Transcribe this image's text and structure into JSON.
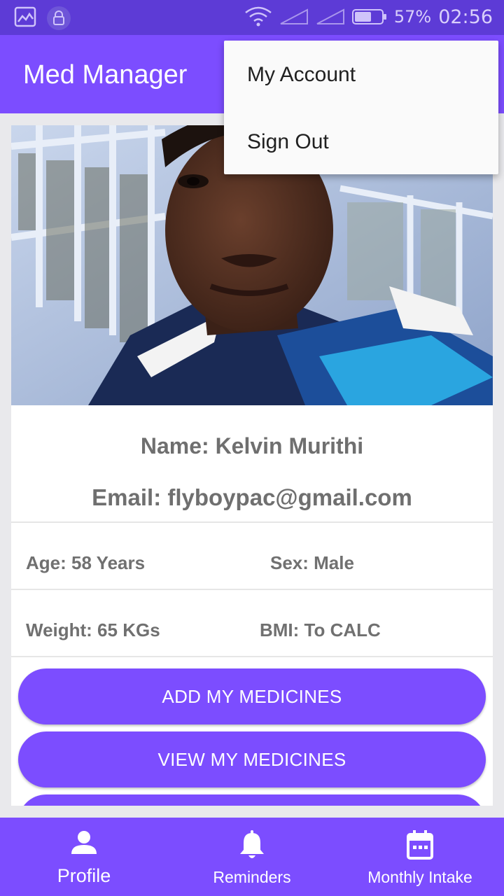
{
  "status_bar": {
    "battery": "57%",
    "time": "02:56",
    "icons": [
      "gallery-icon",
      "lock-icon",
      "wifi-icon",
      "signal-icon",
      "signal-icon",
      "battery-icon"
    ]
  },
  "app_bar": {
    "title": "Med Manager"
  },
  "menu": {
    "items": [
      "My Account",
      "Sign Out"
    ]
  },
  "profile": {
    "name": "Name: Kelvin Murithi",
    "email": "Email: flyboypac@gmail.com",
    "age": "Age: 58 Years",
    "sex": "Sex: Male",
    "weight": "Weight: 65 KGs",
    "bmi": "BMI: To CALC"
  },
  "buttons": {
    "add": "ADD MY MEDICINES",
    "view": "VIEW MY MEDICINES"
  },
  "bottom_nav": {
    "items": [
      {
        "label": "Profile",
        "icon": "person-icon"
      },
      {
        "label": "Reminders",
        "icon": "bell-icon"
      },
      {
        "label": "Monthly Intake",
        "icon": "calendar-icon"
      }
    ]
  },
  "colors": {
    "primary": "#7c4dff",
    "status_bar": "#5d3bd6",
    "text_gray": "#6f6f6f"
  }
}
